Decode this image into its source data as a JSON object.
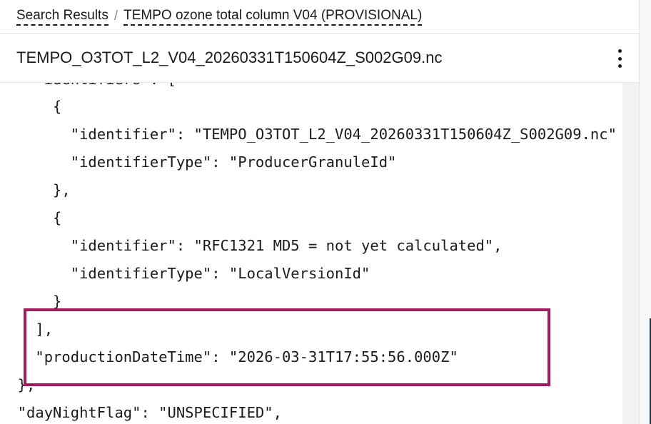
{
  "breadcrumb": {
    "items": [
      "Search Results",
      "TEMPO ozone total column V04 (PROVISIONAL)"
    ],
    "separator": "/"
  },
  "file": {
    "title": "TEMPO_O3TOT_L2_V04_20260331T150604Z_S002G09.nc",
    "menu_icon": "more-vertical-icon"
  },
  "json_lines": [
    "    \"identifiers\": [",
    "      {",
    "        \"identifier\": \"TEMPO_O3TOT_L2_V04_20260331T150604Z_S002G09.nc\"",
    "        \"identifierType\": \"ProducerGranuleId\"",
    "      },",
    "      {",
    "        \"identifier\": \"RFC1321 MD5 = not yet calculated\",",
    "        \"identifierType\": \"LocalVersionId\"",
    "      }",
    "    ],",
    "    \"productionDateTime\": \"2026-03-31T17:55:56.000Z\"",
    "  },",
    "  \"dayNightFlag\": \"UNSPECIFIED\","
  ],
  "colors": {
    "highlight": "#a7195f",
    "text": "#1b1b1b"
  }
}
